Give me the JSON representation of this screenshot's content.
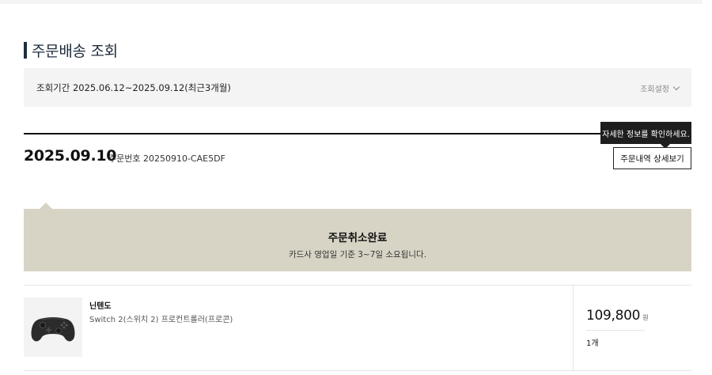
{
  "page": {
    "title": "주문배송 조회"
  },
  "period": {
    "label": "조회기간 2025.06.12~2025.09.12(최근3개월)",
    "setting_label": "조회설정"
  },
  "order": {
    "date": "2025.09.10",
    "number_label": "주문번호 20250910-CAE5DF",
    "tooltip": "자세한 정보를 확인하세요.",
    "detail_button": "주문내역 상세보기"
  },
  "status": {
    "title": "주문취소완료",
    "description": "카드사 영업일 기준 3~7일 소요됩니다."
  },
  "item": {
    "image": "game-controller-image",
    "brand": "닌텐도",
    "name": "Switch 2(스위치 2) 프로컨트롤러(프로콘)",
    "price": "109,800",
    "currency": "원",
    "quantity": "1개"
  },
  "colors": {
    "title_accent": "#1f2d3d",
    "status_bg": "#d8d4c5",
    "tooltip_bg": "#1e1e1e",
    "period_bg": "#f4f4f4"
  }
}
